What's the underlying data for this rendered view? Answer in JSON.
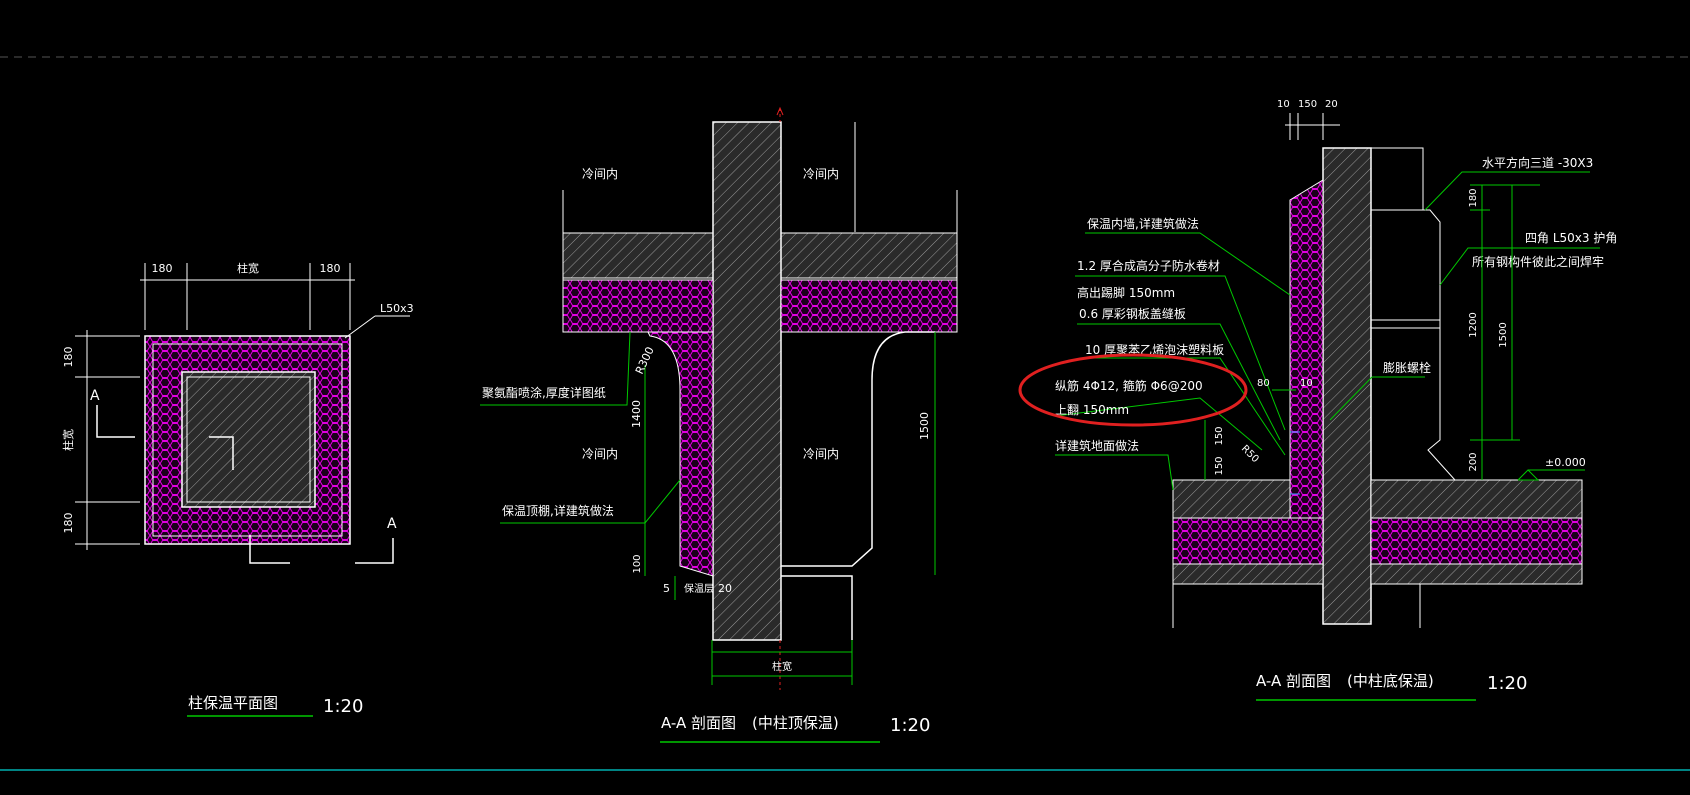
{
  "drawings": {
    "plan": {
      "title": "柱保温平面图",
      "scale": "1:20",
      "dims": {
        "left": "180",
        "mid": "柱宽",
        "right": "180",
        "v_top": "180",
        "v_mid": "柱宽",
        "v_bot": "180"
      },
      "angle_label": "L50x3",
      "section_mark_a1": "A",
      "section_mark_a2": "A"
    },
    "top_section": {
      "title": "A-A 剖面图",
      "subtitle": "(中柱顶保温)",
      "scale": "1:20",
      "room_tl": "冷间内",
      "room_tr": "冷间内",
      "room_ml": "冷间内",
      "room_mr": "冷间内",
      "note_spray": "聚氨酯喷涂,厚度详图纸",
      "note_layer": "保温顶棚,详建筑做法",
      "dim_r300": "R300",
      "dim_1400": "1400",
      "dim_1500": "1500",
      "dim_100": "100",
      "dim_5": "5",
      "dim_thick": "保温层",
      "dim_20": "20",
      "dim_colwidth": "柱宽"
    },
    "bottom_section": {
      "title": "A-A 剖面图",
      "subtitle": "(中柱底保温)",
      "scale": "1:20",
      "dim_10a": "10",
      "dim_150": "150",
      "dim_20": "20",
      "note_wall": "保温内墙,详建筑做法",
      "note_membrane": "1.2 厚合成高分子防水卷材",
      "note_plinth": "高出踢脚 150mm",
      "note_steel": "0.6 厚彩钢板盖缝板",
      "note_foam": "10 厚聚苯乙烯泡沫塑料板",
      "note_rebar": "纵筋 4Φ12, 箍筋 Φ6@200",
      "note_rebar2": "上翻 150mm",
      "note_floor": "详建筑地面做法",
      "note_flat": "水平方向三道  -30X3",
      "note_angle": "四角 L50x3 护角",
      "note_weld": "所有钢构件彼此之间焊牢",
      "note_bolt": "膨胀螺栓",
      "dim_80": "80",
      "dim_10b": "10",
      "dim_150a": "150",
      "dim_150b": "150",
      "dim_r50": "R50",
      "dim_180": "180",
      "dim_1200": "1200",
      "dim_1500": "1500",
      "dim_200": "200",
      "level": "±0.000"
    }
  },
  "colors": {
    "background": "#000000",
    "line_white": "#ffffff",
    "leader_green": "#00c800",
    "insulation_magenta": "#e000e0",
    "highlight_red": "#e02020",
    "border_cyan": "#00b0b0"
  }
}
